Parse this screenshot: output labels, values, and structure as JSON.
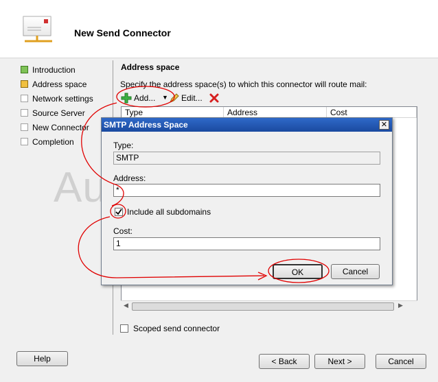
{
  "wizard": {
    "title": "New Send Connector",
    "steps": [
      {
        "label": "Introduction",
        "state": "done"
      },
      {
        "label": "Address space",
        "state": "current"
      },
      {
        "label": "Network settings",
        "state": "todo"
      },
      {
        "label": "Source Server",
        "state": "todo"
      },
      {
        "label": "New Connector",
        "state": "todo"
      },
      {
        "label": "Completion",
        "state": "todo"
      }
    ]
  },
  "main": {
    "section_title": "Address space",
    "description": "Specify the address space(s) to which this connector will route mail:",
    "toolbar": {
      "add_label": "Add...",
      "edit_label": "Edit..."
    },
    "columns": [
      "Type",
      "Address",
      "Cost"
    ],
    "scoped_label": "Scoped send connector",
    "scoped_checked": false
  },
  "dialog": {
    "title": "SMTP Address Space",
    "close_glyph": "✕",
    "type_label": "Type:",
    "type_value": "SMTP",
    "address_label": "Address:",
    "address_value": "*",
    "subdomains_label": "Include all subdomains",
    "subdomains_checked": true,
    "cost_label": "Cost:",
    "cost_value": "1",
    "ok_label": "OK",
    "cancel_label": "Cancel"
  },
  "footer": {
    "help_label": "Help",
    "back_label": "< Back",
    "next_label": "Next >",
    "cancel_label": "Cancel"
  },
  "watermark": "Aurel Proorocu",
  "colors": {
    "annotation": "#e00000",
    "step_done": "#7fc257",
    "step_current": "#f0c040",
    "dialog_title": "#2f69c8"
  }
}
